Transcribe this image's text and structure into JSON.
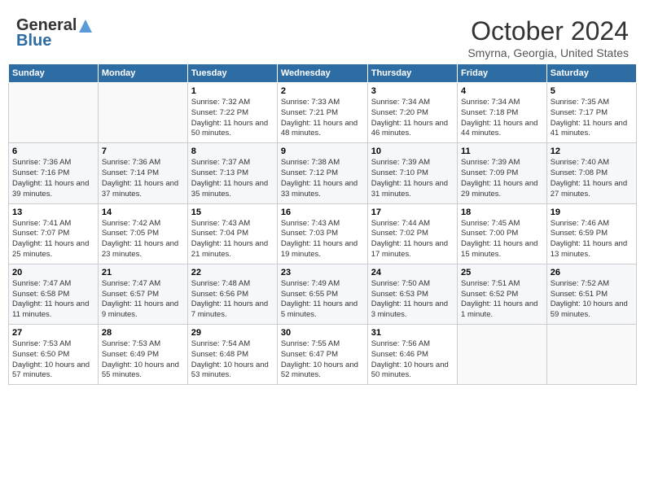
{
  "header": {
    "logo_line1": "General",
    "logo_line2": "Blue",
    "month": "October 2024",
    "location": "Smyrna, Georgia, United States"
  },
  "weekdays": [
    "Sunday",
    "Monday",
    "Tuesday",
    "Wednesday",
    "Thursday",
    "Friday",
    "Saturday"
  ],
  "weeks": [
    [
      {
        "day": "",
        "sunrise": "",
        "sunset": "",
        "daylight": ""
      },
      {
        "day": "",
        "sunrise": "",
        "sunset": "",
        "daylight": ""
      },
      {
        "day": "1",
        "sunrise": "Sunrise: 7:32 AM",
        "sunset": "Sunset: 7:22 PM",
        "daylight": "Daylight: 11 hours and 50 minutes."
      },
      {
        "day": "2",
        "sunrise": "Sunrise: 7:33 AM",
        "sunset": "Sunset: 7:21 PM",
        "daylight": "Daylight: 11 hours and 48 minutes."
      },
      {
        "day": "3",
        "sunrise": "Sunrise: 7:34 AM",
        "sunset": "Sunset: 7:20 PM",
        "daylight": "Daylight: 11 hours and 46 minutes."
      },
      {
        "day": "4",
        "sunrise": "Sunrise: 7:34 AM",
        "sunset": "Sunset: 7:18 PM",
        "daylight": "Daylight: 11 hours and 44 minutes."
      },
      {
        "day": "5",
        "sunrise": "Sunrise: 7:35 AM",
        "sunset": "Sunset: 7:17 PM",
        "daylight": "Daylight: 11 hours and 41 minutes."
      }
    ],
    [
      {
        "day": "6",
        "sunrise": "Sunrise: 7:36 AM",
        "sunset": "Sunset: 7:16 PM",
        "daylight": "Daylight: 11 hours and 39 minutes."
      },
      {
        "day": "7",
        "sunrise": "Sunrise: 7:36 AM",
        "sunset": "Sunset: 7:14 PM",
        "daylight": "Daylight: 11 hours and 37 minutes."
      },
      {
        "day": "8",
        "sunrise": "Sunrise: 7:37 AM",
        "sunset": "Sunset: 7:13 PM",
        "daylight": "Daylight: 11 hours and 35 minutes."
      },
      {
        "day": "9",
        "sunrise": "Sunrise: 7:38 AM",
        "sunset": "Sunset: 7:12 PM",
        "daylight": "Daylight: 11 hours and 33 minutes."
      },
      {
        "day": "10",
        "sunrise": "Sunrise: 7:39 AM",
        "sunset": "Sunset: 7:10 PM",
        "daylight": "Daylight: 11 hours and 31 minutes."
      },
      {
        "day": "11",
        "sunrise": "Sunrise: 7:39 AM",
        "sunset": "Sunset: 7:09 PM",
        "daylight": "Daylight: 11 hours and 29 minutes."
      },
      {
        "day": "12",
        "sunrise": "Sunrise: 7:40 AM",
        "sunset": "Sunset: 7:08 PM",
        "daylight": "Daylight: 11 hours and 27 minutes."
      }
    ],
    [
      {
        "day": "13",
        "sunrise": "Sunrise: 7:41 AM",
        "sunset": "Sunset: 7:07 PM",
        "daylight": "Daylight: 11 hours and 25 minutes."
      },
      {
        "day": "14",
        "sunrise": "Sunrise: 7:42 AM",
        "sunset": "Sunset: 7:05 PM",
        "daylight": "Daylight: 11 hours and 23 minutes."
      },
      {
        "day": "15",
        "sunrise": "Sunrise: 7:43 AM",
        "sunset": "Sunset: 7:04 PM",
        "daylight": "Daylight: 11 hours and 21 minutes."
      },
      {
        "day": "16",
        "sunrise": "Sunrise: 7:43 AM",
        "sunset": "Sunset: 7:03 PM",
        "daylight": "Daylight: 11 hours and 19 minutes."
      },
      {
        "day": "17",
        "sunrise": "Sunrise: 7:44 AM",
        "sunset": "Sunset: 7:02 PM",
        "daylight": "Daylight: 11 hours and 17 minutes."
      },
      {
        "day": "18",
        "sunrise": "Sunrise: 7:45 AM",
        "sunset": "Sunset: 7:00 PM",
        "daylight": "Daylight: 11 hours and 15 minutes."
      },
      {
        "day": "19",
        "sunrise": "Sunrise: 7:46 AM",
        "sunset": "Sunset: 6:59 PM",
        "daylight": "Daylight: 11 hours and 13 minutes."
      }
    ],
    [
      {
        "day": "20",
        "sunrise": "Sunrise: 7:47 AM",
        "sunset": "Sunset: 6:58 PM",
        "daylight": "Daylight: 11 hours and 11 minutes."
      },
      {
        "day": "21",
        "sunrise": "Sunrise: 7:47 AM",
        "sunset": "Sunset: 6:57 PM",
        "daylight": "Daylight: 11 hours and 9 minutes."
      },
      {
        "day": "22",
        "sunrise": "Sunrise: 7:48 AM",
        "sunset": "Sunset: 6:56 PM",
        "daylight": "Daylight: 11 hours and 7 minutes."
      },
      {
        "day": "23",
        "sunrise": "Sunrise: 7:49 AM",
        "sunset": "Sunset: 6:55 PM",
        "daylight": "Daylight: 11 hours and 5 minutes."
      },
      {
        "day": "24",
        "sunrise": "Sunrise: 7:50 AM",
        "sunset": "Sunset: 6:53 PM",
        "daylight": "Daylight: 11 hours and 3 minutes."
      },
      {
        "day": "25",
        "sunrise": "Sunrise: 7:51 AM",
        "sunset": "Sunset: 6:52 PM",
        "daylight": "Daylight: 11 hours and 1 minute."
      },
      {
        "day": "26",
        "sunrise": "Sunrise: 7:52 AM",
        "sunset": "Sunset: 6:51 PM",
        "daylight": "Daylight: 10 hours and 59 minutes."
      }
    ],
    [
      {
        "day": "27",
        "sunrise": "Sunrise: 7:53 AM",
        "sunset": "Sunset: 6:50 PM",
        "daylight": "Daylight: 10 hours and 57 minutes."
      },
      {
        "day": "28",
        "sunrise": "Sunrise: 7:53 AM",
        "sunset": "Sunset: 6:49 PM",
        "daylight": "Daylight: 10 hours and 55 minutes."
      },
      {
        "day": "29",
        "sunrise": "Sunrise: 7:54 AM",
        "sunset": "Sunset: 6:48 PM",
        "daylight": "Daylight: 10 hours and 53 minutes."
      },
      {
        "day": "30",
        "sunrise": "Sunrise: 7:55 AM",
        "sunset": "Sunset: 6:47 PM",
        "daylight": "Daylight: 10 hours and 52 minutes."
      },
      {
        "day": "31",
        "sunrise": "Sunrise: 7:56 AM",
        "sunset": "Sunset: 6:46 PM",
        "daylight": "Daylight: 10 hours and 50 minutes."
      },
      {
        "day": "",
        "sunrise": "",
        "sunset": "",
        "daylight": ""
      },
      {
        "day": "",
        "sunrise": "",
        "sunset": "",
        "daylight": ""
      }
    ]
  ]
}
